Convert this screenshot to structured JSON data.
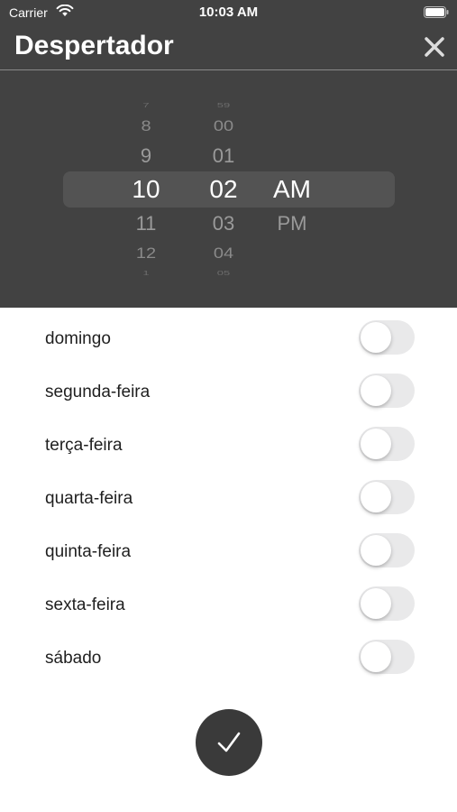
{
  "status_bar": {
    "carrier": "Carrier",
    "time": "10:03 AM"
  },
  "header": {
    "title": "Despertador"
  },
  "picker": {
    "hours": [
      "7",
      "8",
      "9",
      "10",
      "11",
      "12",
      "1"
    ],
    "minutes": [
      "59",
      "00",
      "01",
      "02",
      "03",
      "04",
      "05"
    ],
    "periods": [
      "AM",
      "PM"
    ],
    "selected": {
      "hour": "10",
      "minute": "02",
      "period": "AM"
    }
  },
  "days": [
    {
      "label": "domingo",
      "on": false
    },
    {
      "label": "segunda-feira",
      "on": false
    },
    {
      "label": "terça-feira",
      "on": false
    },
    {
      "label": "quarta-feira",
      "on": false
    },
    {
      "label": "quinta-feira",
      "on": false
    },
    {
      "label": "sexta-feira",
      "on": false
    },
    {
      "label": "sábado",
      "on": false
    }
  ],
  "colors": {
    "header_bg": "#424242",
    "toggle_off": "#e9e9ea",
    "confirm_bg": "#3a3a3a"
  },
  "icons": {
    "wifi": "wifi-icon",
    "battery": "battery-icon",
    "close": "close-icon",
    "confirm": "checkmark-icon"
  }
}
